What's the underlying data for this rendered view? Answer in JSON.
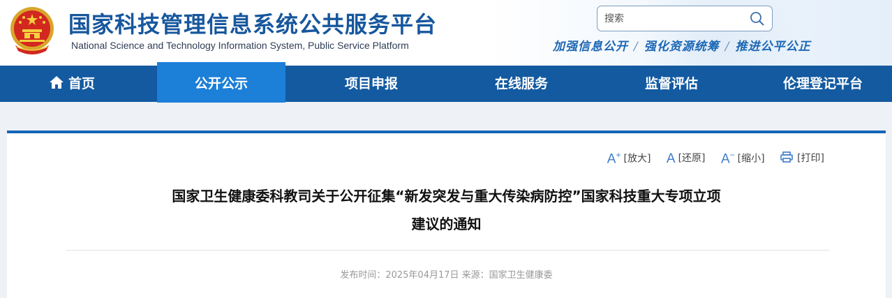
{
  "header": {
    "title": "国家科技管理信息系统公共服务平台",
    "subtitle": "National Science and Technology Information System, Public Service Platform",
    "emblem_icon": "national-emblem-icon",
    "search": {
      "placeholder": "搜索"
    },
    "slogan": [
      "加强信息公开",
      "强化资源统筹",
      "推进公平公正"
    ],
    "slogan_sep": "/"
  },
  "nav": {
    "items": [
      {
        "label": "首页",
        "icon": "home-icon"
      },
      {
        "label": "公开公示",
        "active": true
      },
      {
        "label": "项目申报"
      },
      {
        "label": "在线服务"
      },
      {
        "label": "监督评估"
      },
      {
        "label": "伦理登记平台"
      }
    ]
  },
  "tools": {
    "enlarge": "[放大]",
    "restore": "[还原]",
    "shrink": "[缩小]",
    "print": "[打印]"
  },
  "article": {
    "title_line1": "国家卫生健康委科教司关于公开征集“新发突发与重大传染病防控”国家科技重大专项立项",
    "title_line2": "建议的通知",
    "meta": "发布时间：2025年04月17日 来源：国家卫生健康委"
  },
  "colors": {
    "nav_bg": "#135aa0",
    "nav_active": "#1c7fd8",
    "title": "#17579d",
    "slogan": "#1d67b4"
  }
}
